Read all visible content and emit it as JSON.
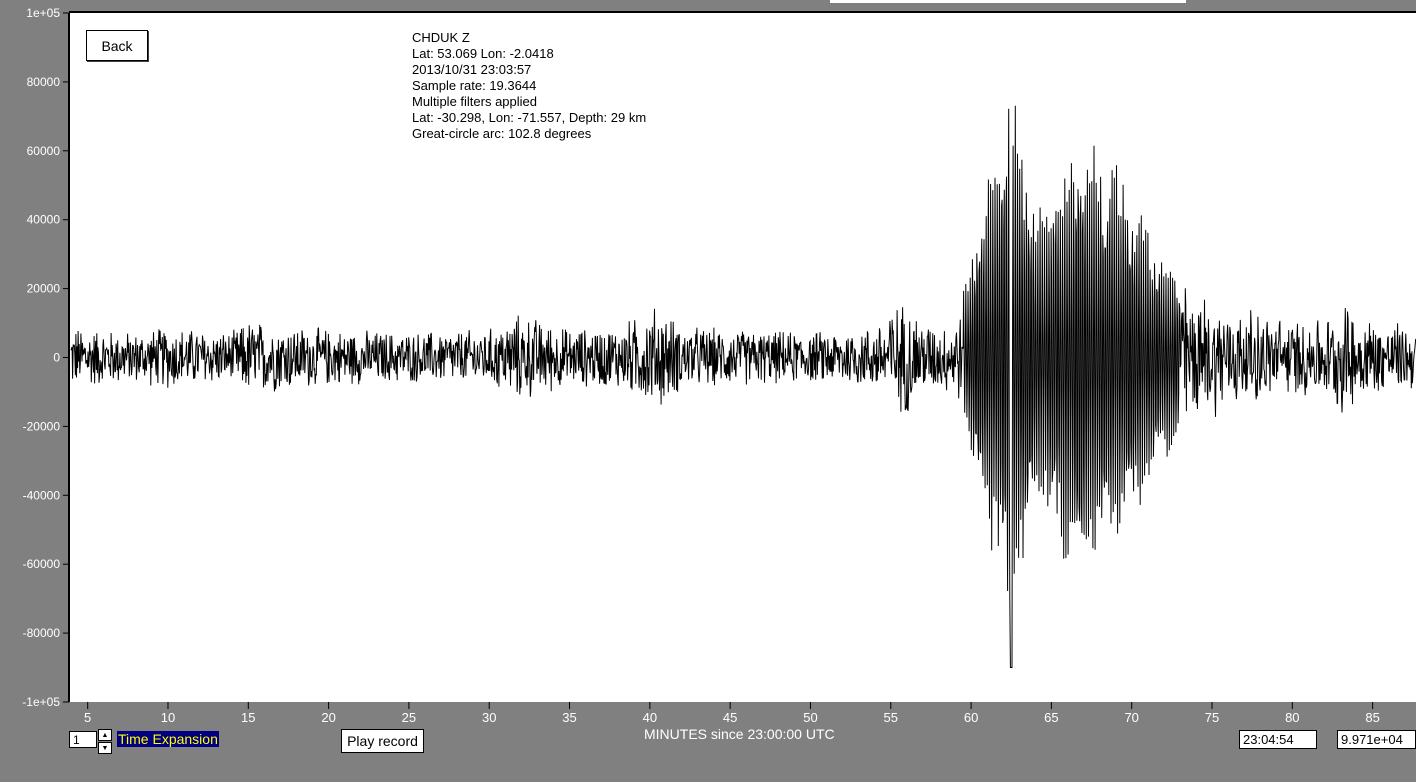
{
  "header": {
    "back_label": "Back"
  },
  "info": {
    "lines": [
      "CHDUK  Z",
      "Lat: 53.069 Lon: -2.0418",
      "2013/10/31 23:03:57",
      "Sample rate: 19.3644",
      "Multiple filters applied",
      "Lat: -30.298, Lon: -71.557, Depth: 29 km",
      "Great-circle arc: 102.8 degrees"
    ]
  },
  "controls": {
    "expansion_value": "1",
    "time_expansion_label": "Time Expansion",
    "play_label": "Play record",
    "xaxis_title": "MINUTES since 23:00:00 UTC",
    "cursor_time": "23:04:54",
    "cursor_amplitude": "9.971e+04"
  },
  "colors": {
    "background": "#808080",
    "plot_area": "#ffffff",
    "trace": "#000000",
    "axis_text": "#ffffff",
    "time_expansion_text": "#ffff00",
    "time_expansion_bg": "#000080"
  },
  "chart_data": {
    "type": "line",
    "title": "",
    "xlabel": "MINUTES since 23:00:00 UTC",
    "ylabel": "",
    "xlim": [
      3.9,
      87.7
    ],
    "ylim": [
      -100000,
      100000
    ],
    "yticks": [
      100000,
      80000,
      60000,
      40000,
      20000,
      0,
      -20000,
      -40000,
      -60000,
      -80000,
      -100000
    ],
    "ytick_labels": [
      "1e+05",
      "80000",
      "60000",
      "40000",
      "20000",
      "0",
      "-20000",
      "-40000",
      "-60000",
      "-80000",
      "-1e+05"
    ],
    "xticks": [
      5,
      10,
      15,
      20,
      25,
      30,
      35,
      40,
      45,
      50,
      55,
      60,
      65,
      70,
      75,
      80,
      85
    ],
    "xtick_labels": [
      "5",
      "10",
      "15",
      "20",
      "25",
      "30",
      "35",
      "40",
      "45",
      "50",
      "55",
      "60",
      "65",
      "70",
      "75",
      "80",
      "85"
    ],
    "grid": false,
    "series": [
      {
        "envelope_x": [
          3.9,
          8,
          10,
          14,
          15,
          20,
          25,
          30,
          32,
          35,
          38,
          40,
          40.5,
          42,
          45,
          50,
          54,
          55,
          56,
          57,
          58,
          59,
          59.8,
          60.5,
          61.5,
          62.2,
          62.5,
          63,
          63.8,
          64.5,
          65,
          66,
          66.8,
          67.5,
          68.5,
          69.5,
          70.5,
          71.5,
          72.5,
          73.5,
          75,
          77,
          80,
          82.5,
          83,
          84,
          85,
          87.7
        ],
        "envelope_amp": [
          10000,
          8000,
          10000,
          8000,
          12000,
          9000,
          8000,
          9000,
          14000,
          9000,
          10000,
          15000,
          17000,
          10000,
          9000,
          8000,
          10000,
          16000,
          18000,
          12000,
          10000,
          12000,
          24000,
          45000,
          60000,
          80000,
          88000,
          72000,
          50000,
          42000,
          52000,
          62000,
          68000,
          65000,
          60000,
          55000,
          45000,
          35000,
          28000,
          22000,
          18000,
          15000,
          12000,
          13000,
          18000,
          15000,
          12000,
          10000
        ],
        "dominant_period_min": 0.14,
        "peak_min": 62.5,
        "peak_value": -90000,
        "values_note_max": 83000
      }
    ]
  }
}
